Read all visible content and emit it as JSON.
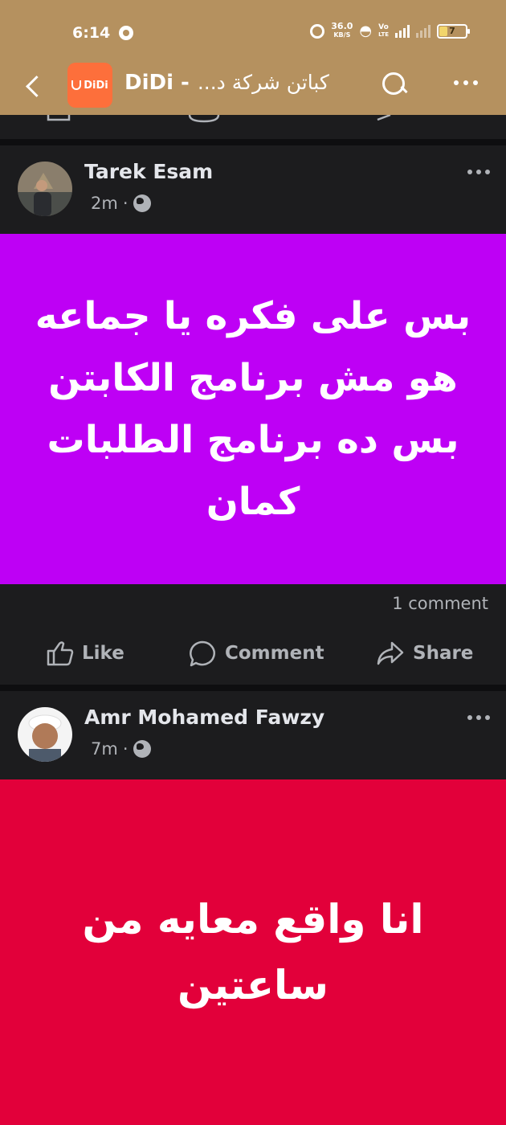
{
  "status_bar": {
    "time": "6:14",
    "net_speed_value": "36.0",
    "net_speed_unit": "KB/S",
    "volte_top": "Vo",
    "volte_bottom": "LTE",
    "battery_level": "7"
  },
  "navbar": {
    "app_logo_text": "DiDi",
    "title_prefix": "DiDi -",
    "title_arabic": "كباتن شركة د...",
    "colors": {
      "header_bg": "#b5915f",
      "logo_bg": "#fd6f3b"
    }
  },
  "posts": [
    {
      "author": "Tarek Esam",
      "time": "2m",
      "separator": "·",
      "text": "بس على فكره يا جماعه\nهو مش برنامج الكابتن\nبس ده برنامج الطلبات\nكمان",
      "card_color": "#be00f5",
      "comments": "1 comment",
      "actions": {
        "like": "Like",
        "comment": "Comment",
        "share": "Share"
      }
    },
    {
      "author": "Amr Mohamed Fawzy",
      "time": "7m",
      "separator": "·",
      "text": "انا واقع معايه من\nساعتين",
      "card_color": "#e2003a"
    }
  ]
}
